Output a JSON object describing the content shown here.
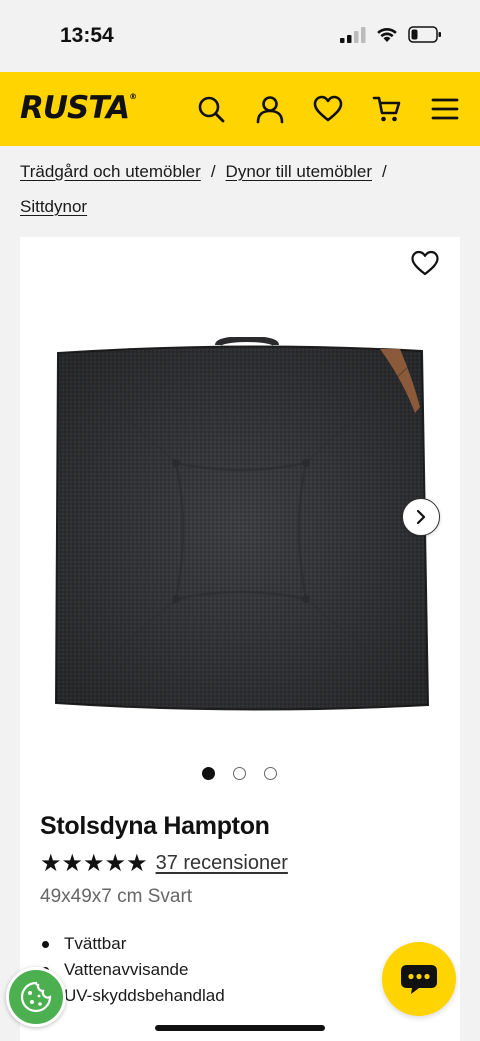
{
  "status_bar": {
    "time": "13:54"
  },
  "header": {
    "logo": "RUSTA",
    "logo_mark": "®",
    "icons": [
      "search-icon",
      "account-icon",
      "heart-icon",
      "cart-icon",
      "menu-icon"
    ],
    "brand_color": "#ffd400"
  },
  "breadcrumb": {
    "items": [
      "Trädgård och utemöbler",
      "Dynor till utemöbler",
      "Sittdynor"
    ],
    "separator": "/"
  },
  "product": {
    "title": "Stolsdyna Hampton",
    "stars_display": "★★★★★",
    "rating": 5,
    "rating_max": 5,
    "reviews_label": "37 recensioner",
    "variant": "49x49x7 cm Svart",
    "features": [
      "Tvättbar",
      "Vattenavvisande",
      "UV-skyddsbehandlad"
    ],
    "gallery": {
      "total": 3,
      "active_index": 0
    }
  },
  "floating": {
    "chat_icon": "chat-bubble-icon",
    "cookie_icon": "cookie-icon"
  }
}
